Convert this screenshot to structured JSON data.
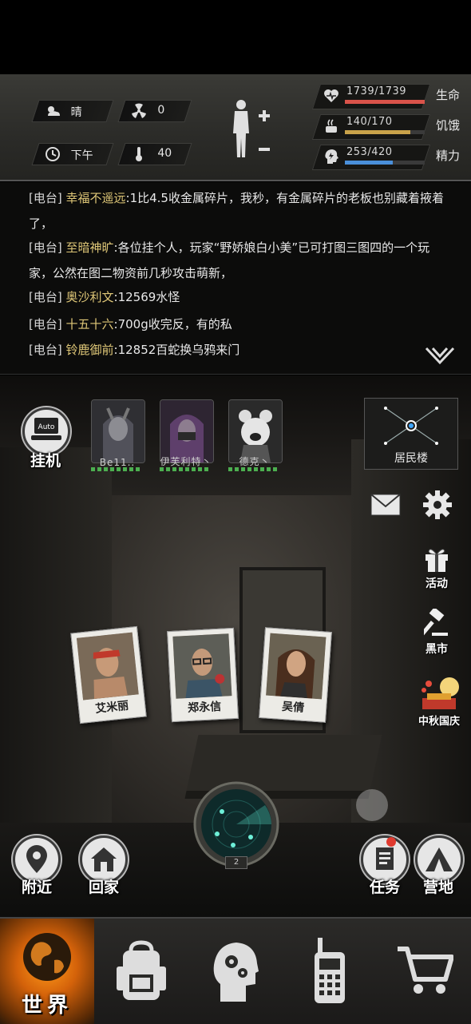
{
  "status": {
    "weather": "晴",
    "radiation": "0",
    "time_of_day": "下午",
    "temperature": "40",
    "health": {
      "value": "1739/1739",
      "label": "生命",
      "fraction": 1.0,
      "color": "#d9534a"
    },
    "hunger": {
      "value": "140/170",
      "label": "饥饿",
      "fraction": 0.82,
      "color": "#c9a24a"
    },
    "energy": {
      "value": "253/420",
      "label": "精力",
      "fraction": 0.6,
      "color": "#4a8fd9"
    }
  },
  "feed": {
    "messages": [
      {
        "channel": "[电台]",
        "sender": "幸福不遥远",
        "text": ":1比4.5收金属碎片，我秒，有金属碎片的老板也别藏着掖着了，"
      },
      {
        "channel": "[电台]",
        "sender": "至暗神旷",
        "text": ":各位挂个人，玩家“野娇娘白小美”已可打图三图四的一个玩家，公然在图二物资前几秒攻击萌新，"
      },
      {
        "channel": "[电台]",
        "sender": "奥沙利文",
        "text": ":12569水怪"
      },
      {
        "channel": "[电台]",
        "sender": "十五十六",
        "text": ":700g收完反，有的私"
      },
      {
        "channel": "[电台]",
        "sender": "铃鹿御前",
        "text": ":12852百蛇换乌鸦来门"
      }
    ]
  },
  "scene": {
    "auto_label": "Auto",
    "idle_label": "挂机",
    "squad": [
      {
        "name": "Be11.."
      },
      {
        "name": "伊芙利特丶"
      },
      {
        "name": "德克丶"
      }
    ],
    "location": "居民楼",
    "side_menu": {
      "event_label": "活动",
      "market_label": "黑市",
      "festival_label": "中秋国庆"
    },
    "npcs": [
      {
        "name": "艾米丽"
      },
      {
        "name": "郑永信"
      },
      {
        "name": "吴倩"
      }
    ],
    "radar_level": "2",
    "nearby_label": "附近",
    "home_label": "回家",
    "task_label": "任务",
    "camp_label": "营地"
  },
  "nav": {
    "world_label": "世界"
  }
}
